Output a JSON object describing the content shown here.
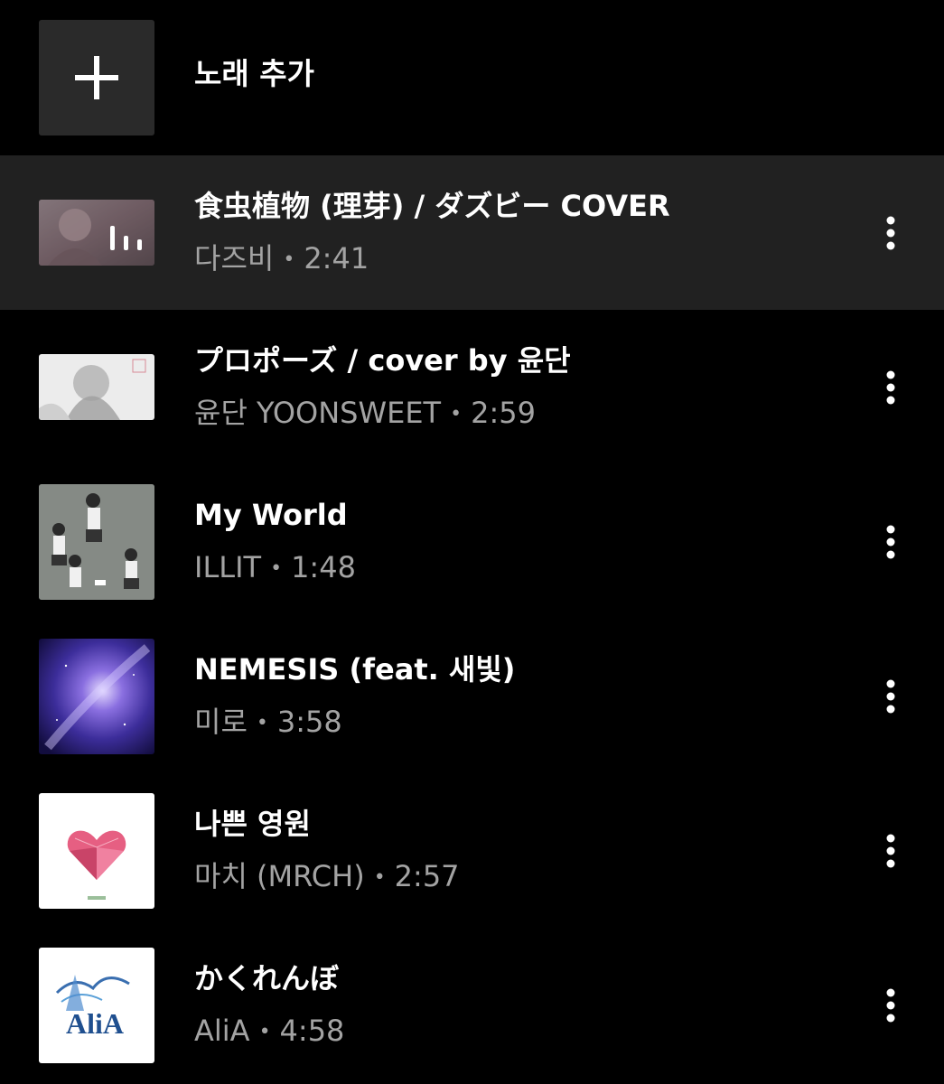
{
  "add_song": {
    "label": "노래 추가",
    "icon": "plus-icon"
  },
  "tracks": [
    {
      "title": "食虫植物 (理芽) / ダズビー COVER",
      "artist": "다즈비",
      "duration": "2:41",
      "now_playing": true,
      "artwork": "anime-girl-illustration"
    },
    {
      "title": "プロポーズ / cover by 윤단",
      "artist": "윤단 YOONSWEET",
      "duration": "2:59",
      "now_playing": false,
      "artwork": "anime-sketch-illustration"
    },
    {
      "title": "My World",
      "artist": "ILLIT",
      "duration": "1:48",
      "now_playing": false,
      "artwork": "group-photo"
    },
    {
      "title": "NEMESIS (feat. 새빛)",
      "artist": "미로",
      "duration": "3:58",
      "now_playing": false,
      "artwork": "galaxy-artwork"
    },
    {
      "title": "나쁜 영원",
      "artist": "마치 (MRCH)",
      "duration": "2:57",
      "now_playing": false,
      "artwork": "heart-gem-artwork"
    },
    {
      "title": "かくれんぼ",
      "artist": "AliA",
      "duration": "4:58",
      "now_playing": false,
      "artwork": "alia-logo-artwork"
    }
  ],
  "colors": {
    "background": "#000000",
    "active_row": "#212121",
    "secondary_text": "#a3a3a3",
    "primary_text": "#ffffff"
  }
}
